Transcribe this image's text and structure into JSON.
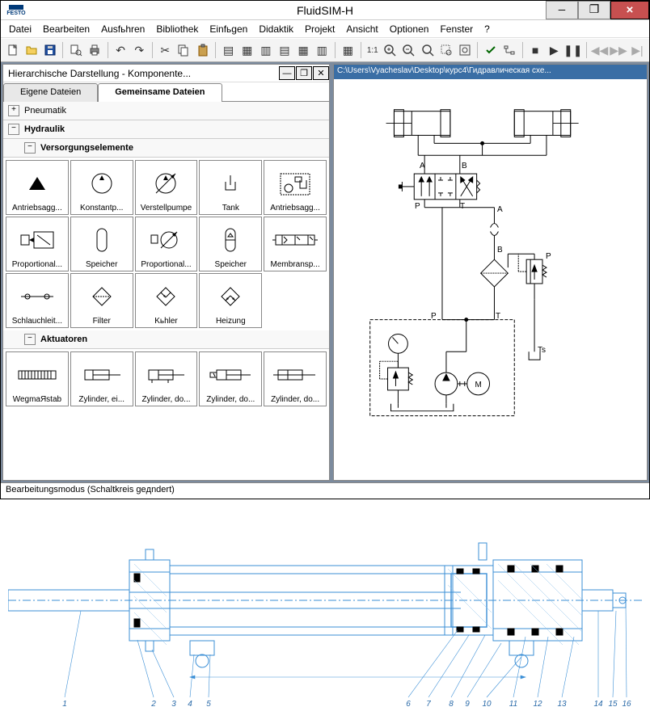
{
  "titlebar": {
    "logo": "FESTO",
    "title": "FluidSIM-H",
    "min": "—",
    "max": "❐",
    "close": "✕"
  },
  "menubar": [
    "Datei",
    "Bearbeiten",
    "Ausfьhren",
    "Bibliothek",
    "Einfьgen",
    "Didaktik",
    "Projekt",
    "Ansicht",
    "Optionen",
    "Fenster",
    "?"
  ],
  "library": {
    "title": "Hierarchische Darstellung - Komponente...",
    "tabs": {
      "own": "Eigene Dateien",
      "shared": "Gemeinsame Dateien"
    },
    "cats": {
      "pneumatik": "Pneumatik",
      "hydraulik": "Hydraulik",
      "verso": "Versorgungselemente",
      "aktu": "Aktuatoren"
    },
    "items_v": [
      "Antriebsagg...",
      "Konstantp...",
      "Verstellpumpe",
      "Tank",
      "Antriebsagg...",
      "Proportional...",
      "Speicher",
      "Proportional...",
      "Speicher",
      "Membransp...",
      "Schlauchleit...",
      "Filter",
      "Kьhler",
      "Heizung"
    ],
    "items_a": [
      "WegmaЯstab",
      "Zylinder, ei...",
      "Zylinder, do...",
      "Zylinder, do...",
      "Zylinder, do..."
    ]
  },
  "canvas": {
    "title": "C:\\Users\\Vyacheslav\\Desktop\\курс4\\Гидравлическая схе...",
    "labels": {
      "A1": "A",
      "B1": "B",
      "P1": "P",
      "T1": "T",
      "A2": "A",
      "B2": "B",
      "P2": "P",
      "P3": "P",
      "T2": "T",
      "Ts": "Ts",
      "M": "M"
    }
  },
  "statusbar": {
    "text": "Bearbeitungsmodus (Schaltkreis geдndert)"
  },
  "toolbar": {
    "ratio": "1:1"
  }
}
